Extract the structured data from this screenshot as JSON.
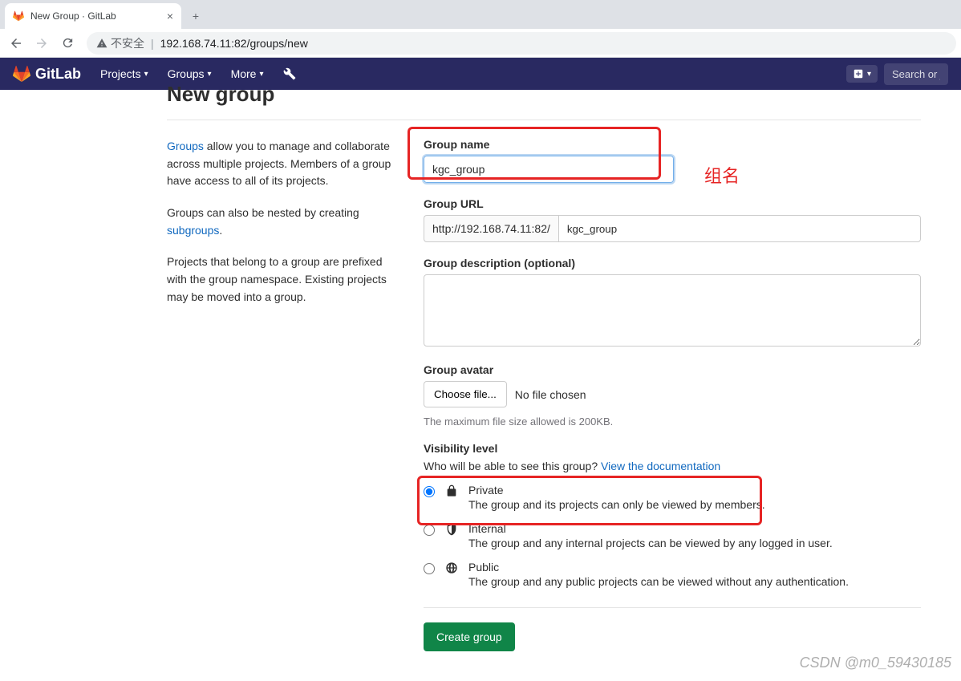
{
  "browser": {
    "tab_title": "New Group · GitLab",
    "security_label": "不安全",
    "url": "192.168.74.11:82/groups/new"
  },
  "nav": {
    "brand": "GitLab",
    "projects": "Projects",
    "groups": "Groups",
    "more": "More",
    "search_placeholder": "Search or ju"
  },
  "page": {
    "title": "New group",
    "help_p1_link": "Groups",
    "help_p1_rest": " allow you to manage and collaborate across multiple projects. Members of a group have access to all of its projects.",
    "help_p2_pre": "Groups can also be nested by creating ",
    "help_p2_link": "subgroups",
    "help_p2_post": ".",
    "help_p3": "Projects that belong to a group are prefixed with the group namespace. Existing projects may be moved into a group."
  },
  "form": {
    "name_label": "Group name",
    "name_value": "kgc_group",
    "annotation": "组名",
    "url_label": "Group URL",
    "url_prefix": "http://192.168.74.11:82/",
    "url_slug": "kgc_group",
    "desc_label": "Group description (optional)",
    "avatar_label": "Group avatar",
    "choose_file": "Choose file...",
    "no_file": "No file chosen",
    "file_note": "The maximum file size allowed is 200KB.",
    "vis_label": "Visibility level",
    "vis_q_pre": "Who will be able to see this group? ",
    "vis_q_link": "View the documentation",
    "vis": {
      "private_t": "Private",
      "private_d": "The group and its projects can only be viewed by members.",
      "internal_t": "Internal",
      "internal_d": "The group and any internal projects can be viewed by any logged in user.",
      "public_t": "Public",
      "public_d": "The group and any public projects can be viewed without any authentication."
    },
    "submit": "Create group"
  },
  "watermark": "CSDN @m0_59430185"
}
